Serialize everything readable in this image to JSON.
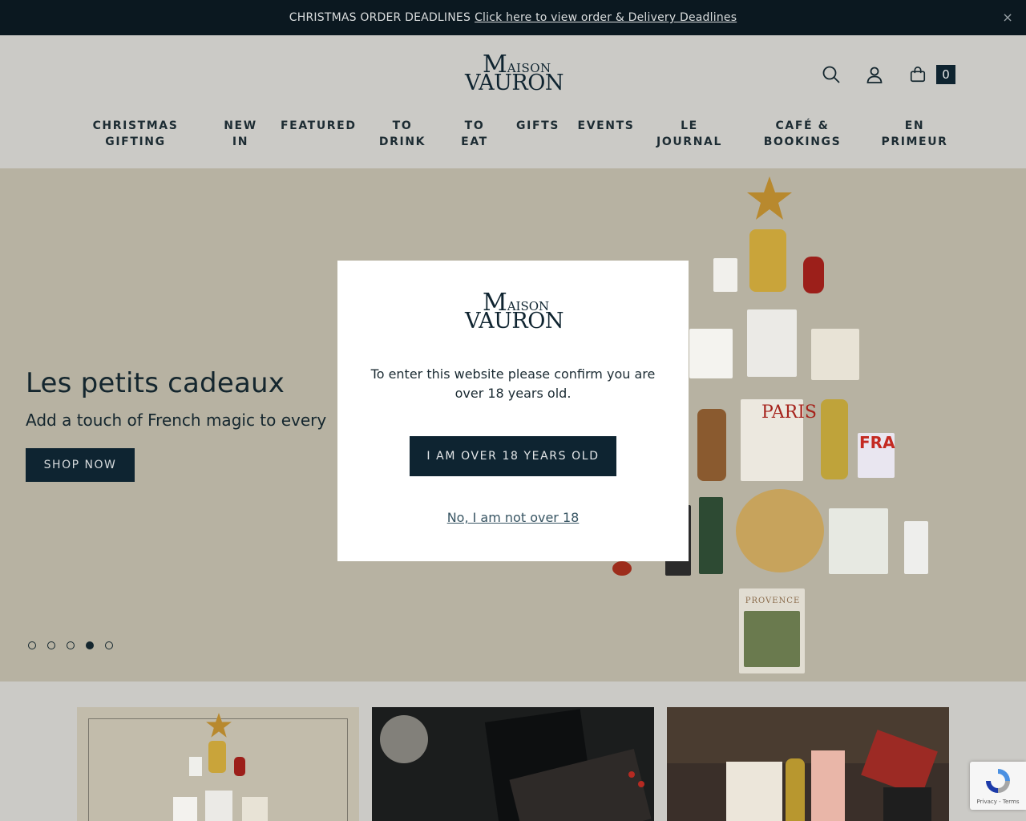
{
  "announcement": {
    "prefix": "CHRISTMAS ORDER DEADLINES",
    "link": "Click here to view order & Delivery Deadlines",
    "close": "×"
  },
  "header": {
    "logo_line1_big": "M",
    "logo_line1_small": "AISON",
    "logo_line2": "VAURON",
    "cart_count": "0"
  },
  "nav": [
    {
      "line1": "CHRISTMAS",
      "line2": "GIFTING"
    },
    {
      "line1": "NEW",
      "line2": "IN"
    },
    {
      "line1": "FEATURED",
      "line2": ""
    },
    {
      "line1": "TO",
      "line2": "DRINK"
    },
    {
      "line1": "TO",
      "line2": "EAT"
    },
    {
      "line1": "GIFTS",
      "line2": ""
    },
    {
      "line1": "EVENTS",
      "line2": ""
    },
    {
      "line1": "LE",
      "line2": "JOURNAL"
    },
    {
      "line1": "CAFÉ &",
      "line2": "BOOKINGS"
    },
    {
      "line1": "EN",
      "line2": "PRIMEUR"
    }
  ],
  "hero": {
    "title": "Les petits cadeaux",
    "subtitle": "Add a touch of French magic to every",
    "cta": "SHOP NOW",
    "slides": 5,
    "active_slide": 4,
    "background": "#b7b2a2"
  },
  "product_labels": {
    "paris": "PARIS",
    "fra": "FRA",
    "provence": "PROVENCE"
  },
  "modal": {
    "logo_line1_big": "M",
    "logo_line1_small": "AISON",
    "logo_line2": "VAURON",
    "message": "To enter this website please confirm you are over 18 years old.",
    "confirm": "I AM OVER 18 YEARS OLD",
    "decline": "No, I am not over 18"
  },
  "recaptcha": {
    "text": "Privacy - Terms"
  },
  "colors": {
    "navy": "#0e2431",
    "announce_bg": "#0b1820",
    "header_bg": "#cbcac6"
  }
}
